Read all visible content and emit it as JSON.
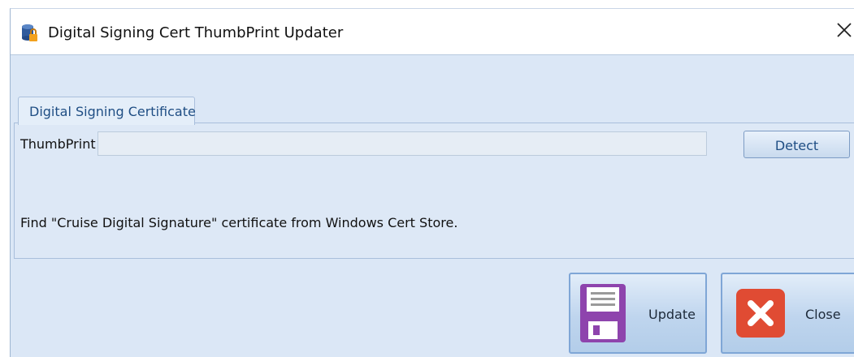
{
  "window": {
    "title": "Digital Signing Cert ThumbPrint Updater",
    "close_glyph": "✕"
  },
  "tab": {
    "label": "Digital Signing Certificate"
  },
  "thumbprint": {
    "label": "ThumbPrint",
    "value": "",
    "detect_label": "Detect"
  },
  "hint": "Find \"Cruise Digital Signature\" certificate from Windows Cert Store.",
  "actions": {
    "update_label": "Update",
    "close_label": "Close"
  },
  "icons": {
    "app": "database-lock-icon",
    "update": "floppy-disk-icon",
    "close": "red-x-icon"
  },
  "colors": {
    "accent": "#1f4e84",
    "panel_bg": "#dde8f6",
    "floppy": "#8e44ad",
    "close_red": "#e04b33"
  }
}
